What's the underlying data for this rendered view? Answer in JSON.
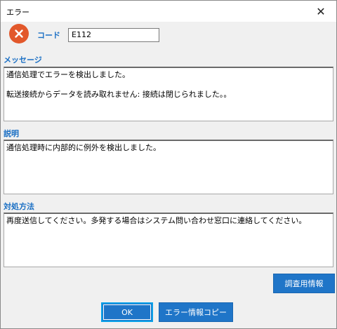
{
  "window": {
    "title": "エラー",
    "close_glyph": "✕"
  },
  "code": {
    "label": "コード",
    "value": "E112"
  },
  "message": {
    "label": "メッセージ",
    "text": "通信処理でエラーを検出しました。\n\n転送接続からデータを読み取れません: 接続は閉じられました。。"
  },
  "description": {
    "label": "説明",
    "text": "通信処理時に内部的に例外を検出しました。"
  },
  "remedy": {
    "label": "対処方法",
    "text": "再度送信してください。多発する場合はシステム問い合わせ窓口に連絡してください。"
  },
  "buttons": {
    "investigation": "調査用情報",
    "ok": "OK",
    "copy": "エラー情報コピー"
  },
  "colors": {
    "accent": "#1a6fc4",
    "button": "#1f75c8",
    "error_icon": "#e2582b"
  }
}
